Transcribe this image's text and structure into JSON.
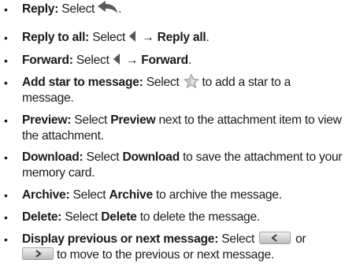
{
  "bullet": "•",
  "arrow": "→",
  "items": [
    {
      "term": "Reply:",
      "pre": "Select",
      "icon": "reply-arrow-icon",
      "post": "."
    },
    {
      "term": "Reply to all:",
      "pre": "Select",
      "icon": "left-triangle-icon",
      "cmd": "Reply all",
      "post": "."
    },
    {
      "term": "Forward:",
      "pre": "Select",
      "icon": "left-triangle-icon",
      "cmd": "Forward",
      "post": "."
    },
    {
      "term": "Add star to message:",
      "pre": "Select",
      "icon": "star-icon",
      "post": "to add a star to a message."
    },
    {
      "term": "Preview:",
      "pre": "Select",
      "cmd": "Preview",
      "post": "next to the attachment item to view the attachment."
    },
    {
      "term": "Download:",
      "pre": "Select",
      "cmd": "Download",
      "post": "to save the attachment to your memory card."
    },
    {
      "term": "Archive:",
      "pre": "Select",
      "cmd": "Archive",
      "post": "to archive the message."
    },
    {
      "term": "Delete:",
      "pre": "Select",
      "cmd": "Delete",
      "post": "to delete the message."
    },
    {
      "term": "Display previous or next message:",
      "pre": "Select",
      "icon": "previous-button-icon",
      "mid": "or",
      "icon2": "next-button-icon",
      "post": "to move to the previous or next message."
    }
  ]
}
